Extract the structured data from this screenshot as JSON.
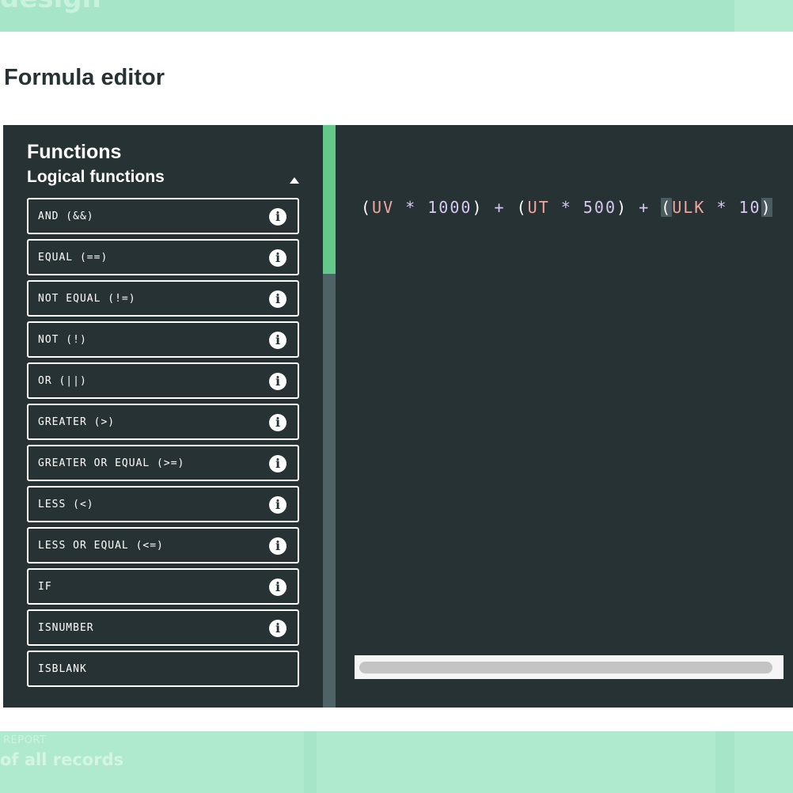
{
  "background": {
    "top_title": "design",
    "bottom_label": "REPORT",
    "bottom_text": "of all records"
  },
  "modal": {
    "title": "Formula editor"
  },
  "functions_panel": {
    "heading": "Functions",
    "group_label": "Logical functions",
    "group_expanded": true,
    "items": [
      {
        "label": "AND (&&)",
        "has_info": true
      },
      {
        "label": "EQUAL (==)",
        "has_info": true
      },
      {
        "label": "NOT EQUAL (!=)",
        "has_info": true
      },
      {
        "label": "NOT (!)",
        "has_info": true
      },
      {
        "label": "OR (||)",
        "has_info": true
      },
      {
        "label": "GREATER (>)",
        "has_info": true
      },
      {
        "label": "GREATER OR EQUAL (>=)",
        "has_info": true
      },
      {
        "label": "LESS (<)",
        "has_info": true
      },
      {
        "label": "LESS OR EQUAL (<=)",
        "has_info": true
      },
      {
        "label": "IF",
        "has_info": true
      },
      {
        "label": "ISNUMBER",
        "has_info": true
      },
      {
        "label": "ISBLANK",
        "has_info": false
      }
    ],
    "info_icon": "info-icon",
    "info_glyph": "i"
  },
  "editor": {
    "tokens": [
      {
        "t": "(",
        "k": "p"
      },
      {
        "t": "UV",
        "k": "v"
      },
      {
        "t": " * ",
        "k": "o"
      },
      {
        "t": "1000",
        "k": "n"
      },
      {
        "t": ")",
        "k": "p"
      },
      {
        "t": " + ",
        "k": "o"
      },
      {
        "t": "(",
        "k": "p"
      },
      {
        "t": "UT",
        "k": "v"
      },
      {
        "t": " * ",
        "k": "o"
      },
      {
        "t": "500",
        "k": "n"
      },
      {
        "t": ")",
        "k": "p"
      },
      {
        "t": " + ",
        "k": "o"
      },
      {
        "t": "(",
        "k": "p",
        "hl": true
      },
      {
        "t": "ULK",
        "k": "v"
      },
      {
        "t": " * ",
        "k": "o"
      },
      {
        "t": "10",
        "k": "n"
      },
      {
        "t": ")",
        "k": "p",
        "hl": true
      }
    ]
  },
  "colors": {
    "accent": "#62c98a",
    "panel_bg": "#273234",
    "variable": "#f0a7a0",
    "number": "#d7c8f0"
  }
}
